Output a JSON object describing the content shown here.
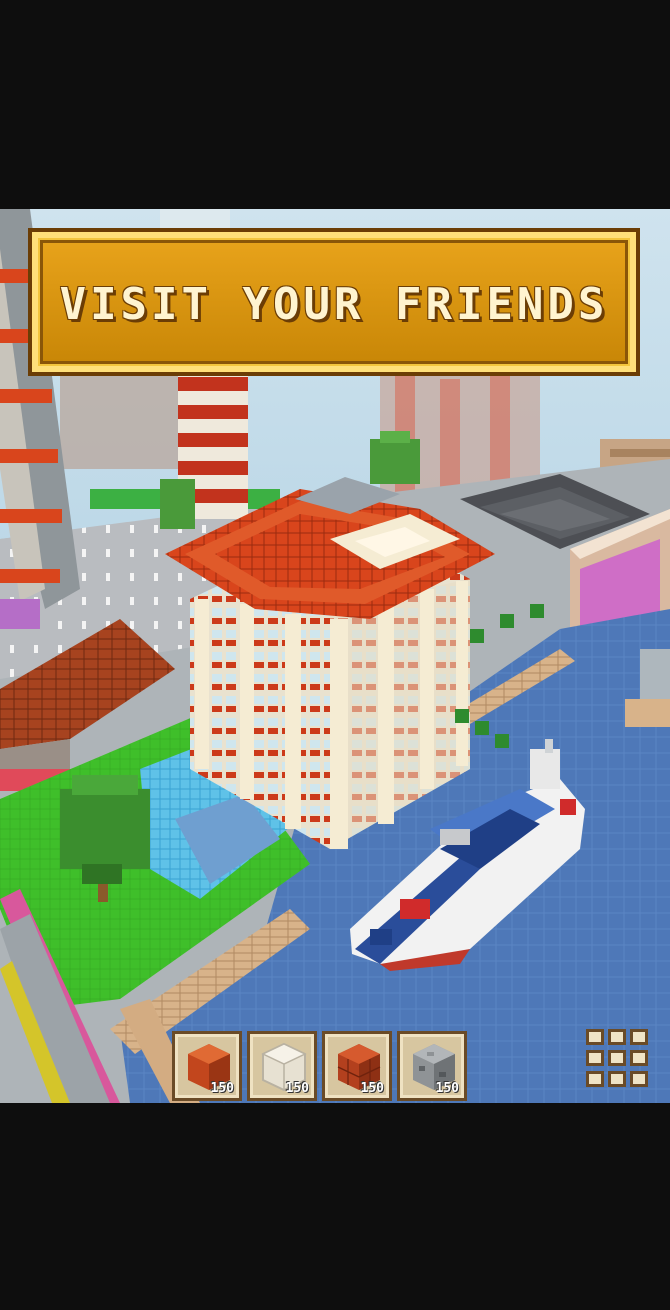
{
  "banner": {
    "title": "VISIT YOUR FRIENDS"
  },
  "hotbar": {
    "slots": [
      {
        "block": "red-clay-block",
        "count": "150",
        "color": "#c2461d"
      },
      {
        "block": "glass-block",
        "count": "150",
        "color": "#e7e1d2"
      },
      {
        "block": "red-brick-block",
        "count": "150",
        "color": "#b3401e"
      },
      {
        "block": "stone-block",
        "count": "150",
        "color": "#8f9396"
      }
    ]
  },
  "menu": {
    "icon": "grid-menu-icon"
  },
  "colors": {
    "banner_gold": "#e7a21a",
    "banner_border": "#6b3d05",
    "roof_red": "#d9451c",
    "water_blue": "#4e78b8",
    "grass_green": "#3fbf2a"
  }
}
